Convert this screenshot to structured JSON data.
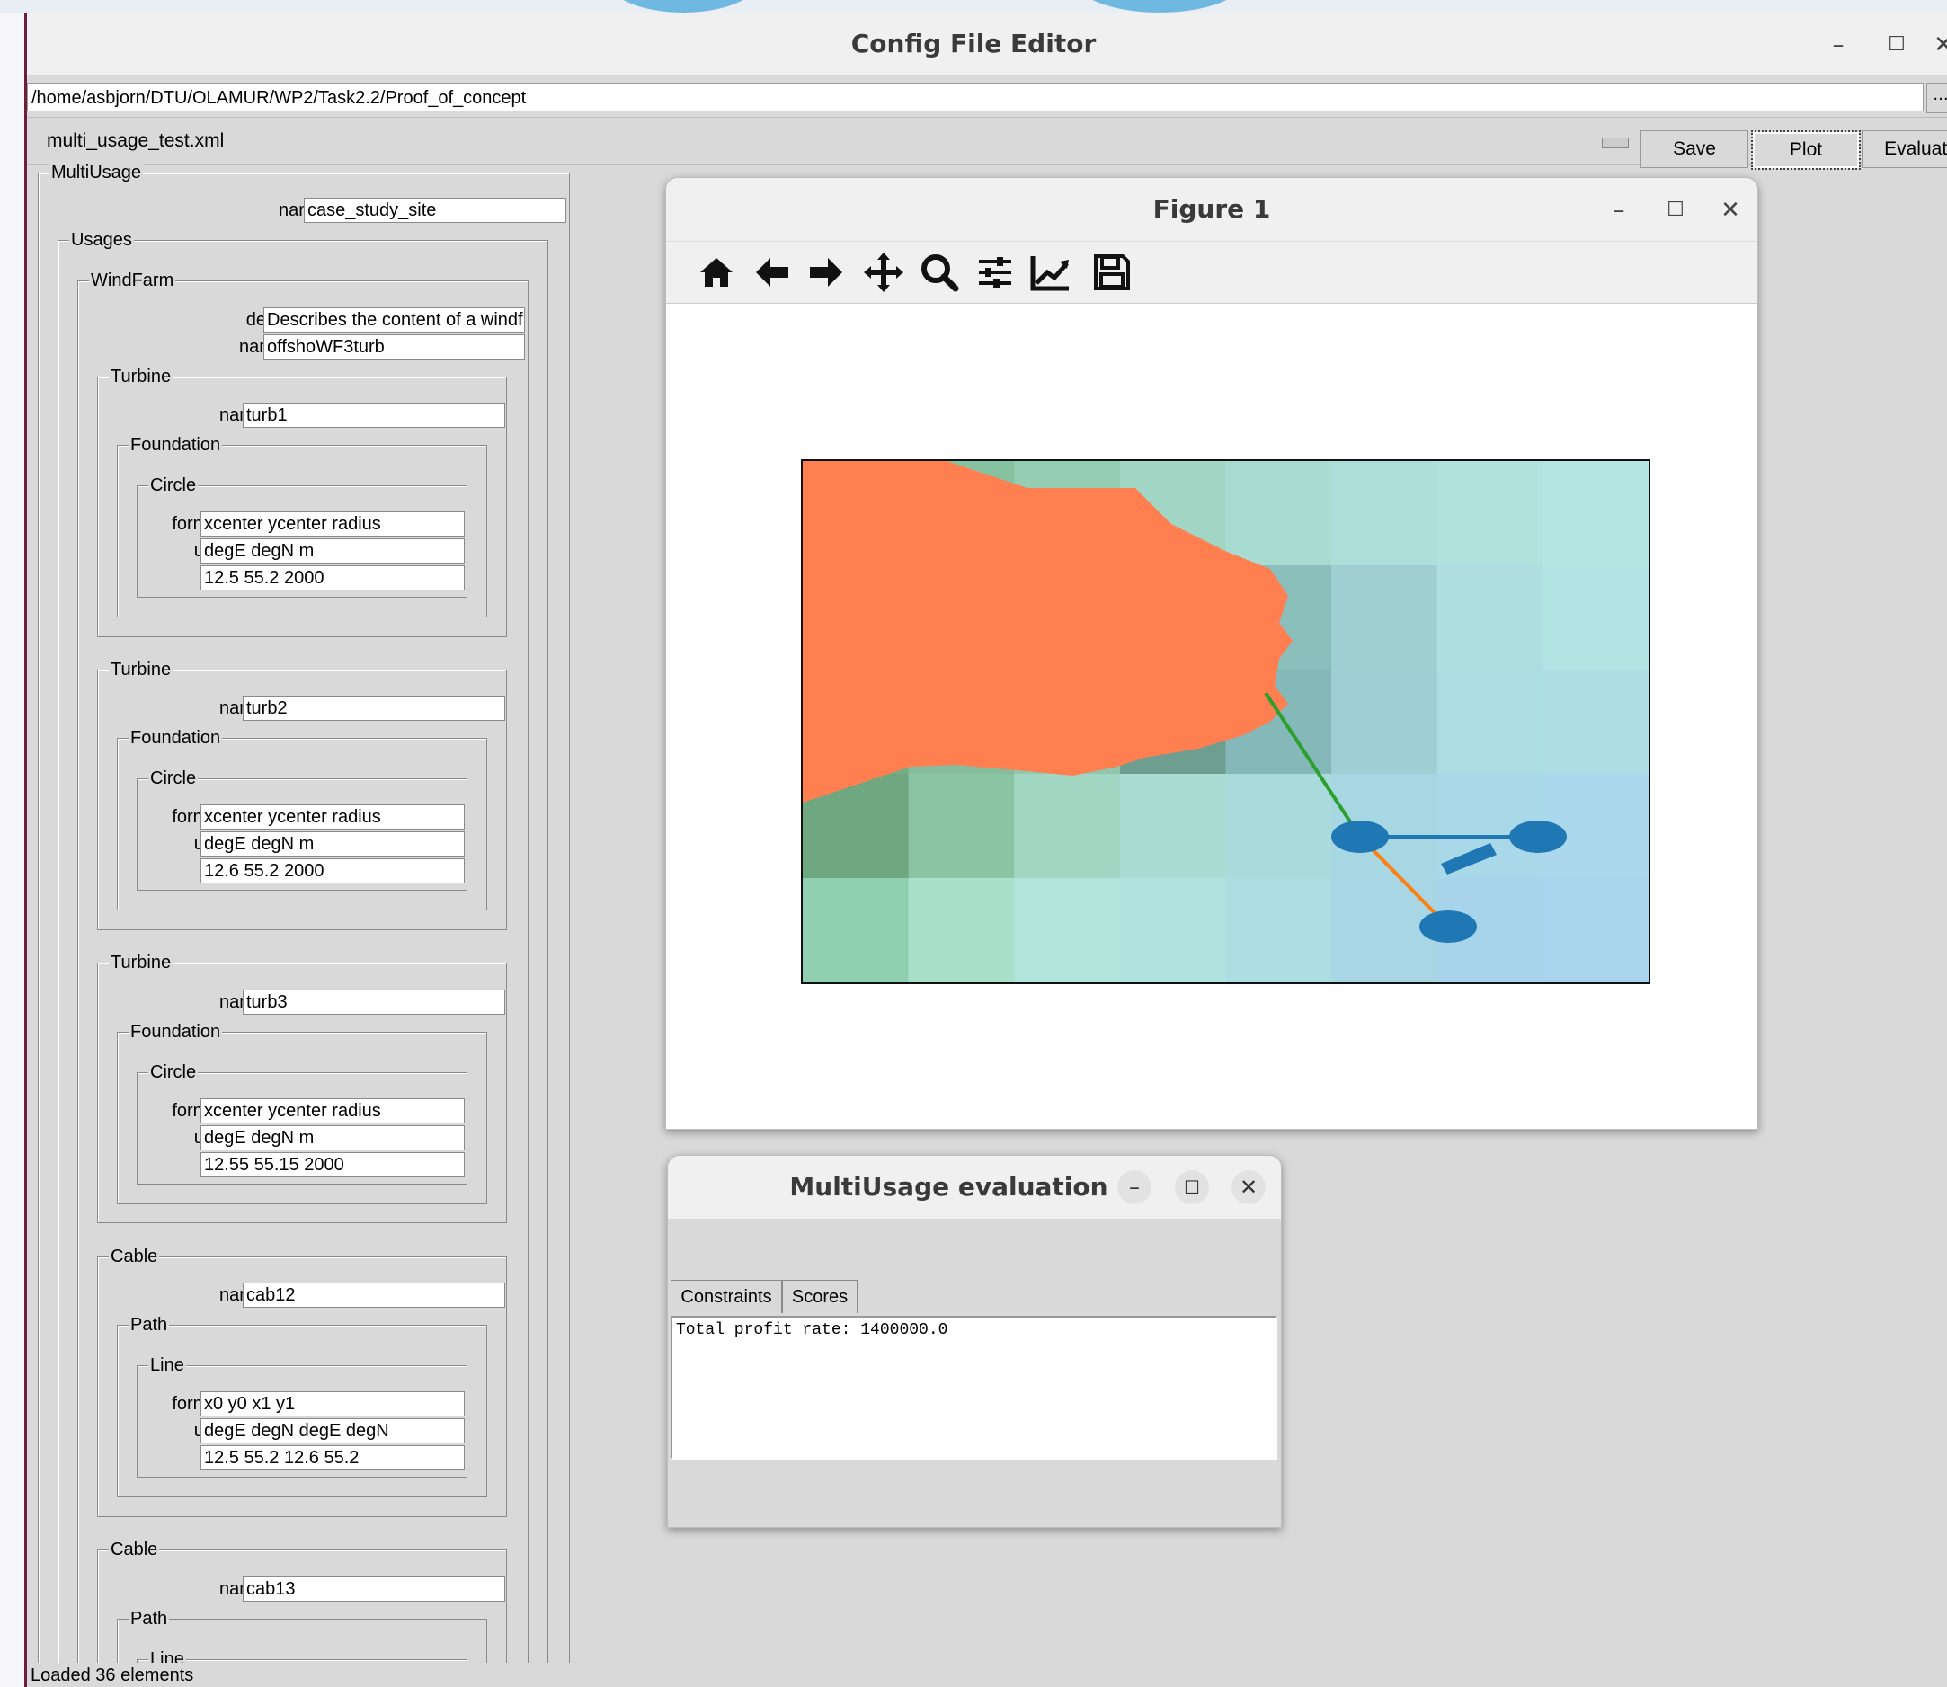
{
  "main_window": {
    "title": "Config File Editor",
    "path": "/home/asbjorn/DTU/OLAMUR/WP2/Task2.2/Proof_of_concept",
    "path_button": "...",
    "filename": "multi_usage_test.xml",
    "buttons": {
      "save": "Save",
      "plot": "Plot",
      "evaluate": "Evaluate"
    },
    "status": "Loaded 36 elements"
  },
  "tree": {
    "multiusage": {
      "label": "MultiUsage",
      "name_label": "name",
      "name_value": "case_study_site"
    },
    "usages_label": "Usages",
    "windfarm": {
      "label": "WindFarm",
      "desc_label": "desc",
      "desc_value": "Describes the content of a windf",
      "name_label": "name",
      "name_value": "offshoWF3turb"
    },
    "turbines": [
      {
        "label": "Turbine",
        "name_label": "name",
        "name_value": "turb1",
        "foundation_label": "Foundation",
        "shape_label": "Circle",
        "format_label": "format",
        "format_value": "xcenter ycenter radius",
        "unit_label": "unit",
        "unit_value": "degE degN m",
        "data_value": "12.5 55.2 2000"
      },
      {
        "label": "Turbine",
        "name_label": "name",
        "name_value": "turb2",
        "foundation_label": "Foundation",
        "shape_label": "Circle",
        "format_label": "format",
        "format_value": "xcenter ycenter radius",
        "unit_label": "unit",
        "unit_value": "degE degN m",
        "data_value": "12.6 55.2 2000"
      },
      {
        "label": "Turbine",
        "name_label": "name",
        "name_value": "turb3",
        "foundation_label": "Foundation",
        "shape_label": "Circle",
        "format_label": "format",
        "format_value": "xcenter ycenter radius",
        "unit_label": "unit",
        "unit_value": "degE degN m",
        "data_value": "12.55 55.15 2000"
      }
    ],
    "cables": [
      {
        "label": "Cable",
        "name_label": "name",
        "name_value": "cab12",
        "path_label": "Path",
        "shape_label": "Line",
        "format_label": "format",
        "format_value": "x0 y0 x1 y1",
        "unit_label": "unit",
        "unit_value": "degE degN degE degN",
        "data_value": "12.5 55.2 12.6 55.2"
      },
      {
        "label": "Cable",
        "name_label": "name",
        "name_value": "cab13",
        "path_label": "Path",
        "shape_label": "Line"
      }
    ]
  },
  "figure": {
    "title": "Figure 1",
    "toolbar": [
      "home-icon",
      "back-arrow-icon",
      "forward-arrow-icon",
      "pan-icon",
      "zoom-icon",
      "configure-subplots-icon",
      "edit-axes-icon",
      "save-icon"
    ],
    "colors": {
      "land": "#ff7f50",
      "cable1": "#1f77b4",
      "cable2": "#ff7f0e",
      "cable3": "#2ca02c",
      "turbine": "#1f77b4"
    }
  },
  "evaluation": {
    "title": "MultiUsage evaluation",
    "tabs": [
      "Constraints",
      "Scores"
    ],
    "output": "Total profit rate: 1400000.0"
  }
}
